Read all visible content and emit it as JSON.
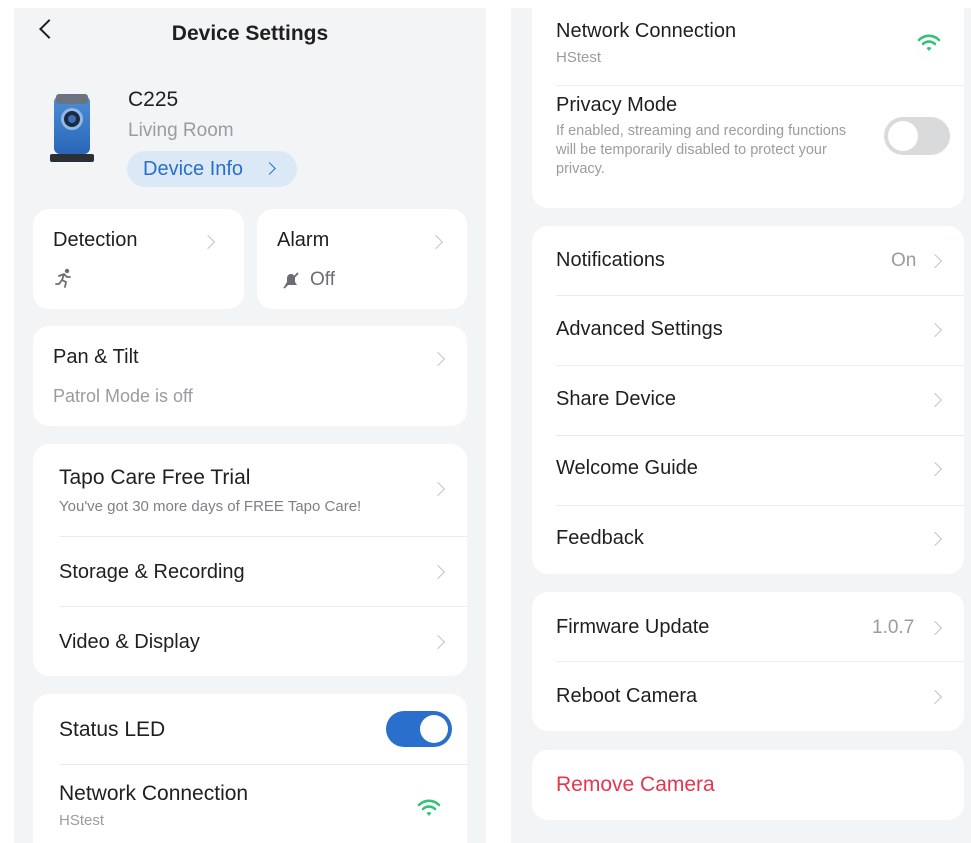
{
  "header": {
    "title": "Device Settings"
  },
  "device": {
    "model": "C225",
    "room": "Living Room",
    "info_button": "Device Info"
  },
  "detection": {
    "label": "Detection"
  },
  "alarm": {
    "label": "Alarm",
    "status": "Off"
  },
  "pan_tilt": {
    "label": "Pan & Tilt",
    "subtitle": "Patrol Mode is off"
  },
  "care": {
    "label": "Tapo Care Free Trial",
    "subtitle": "You've got 30 more days of FREE Tapo Care!"
  },
  "storage": {
    "label": "Storage & Recording"
  },
  "video": {
    "label": "Video & Display"
  },
  "status_led": {
    "label": "Status LED",
    "enabled": true
  },
  "network": {
    "label": "Network Connection",
    "ssid": "HStest"
  },
  "privacy": {
    "label": "Privacy Mode",
    "description": "If enabled, streaming and recording functions will be temporarily disabled to protect your privacy.",
    "enabled": false
  },
  "notifications": {
    "label": "Notifications",
    "value": "On"
  },
  "advanced": {
    "label": "Advanced Settings"
  },
  "share": {
    "label": "Share Device"
  },
  "welcome": {
    "label": "Welcome Guide"
  },
  "feedback": {
    "label": "Feedback"
  },
  "firmware": {
    "label": "Firmware Update",
    "value": "1.0.7"
  },
  "reboot": {
    "label": "Reboot Camera"
  },
  "remove": {
    "label": "Remove Camera"
  },
  "colors": {
    "accent": "#2a6fcb",
    "danger": "#e8344e",
    "wifi": "#34c27a",
    "background": "#f3f4f6"
  }
}
